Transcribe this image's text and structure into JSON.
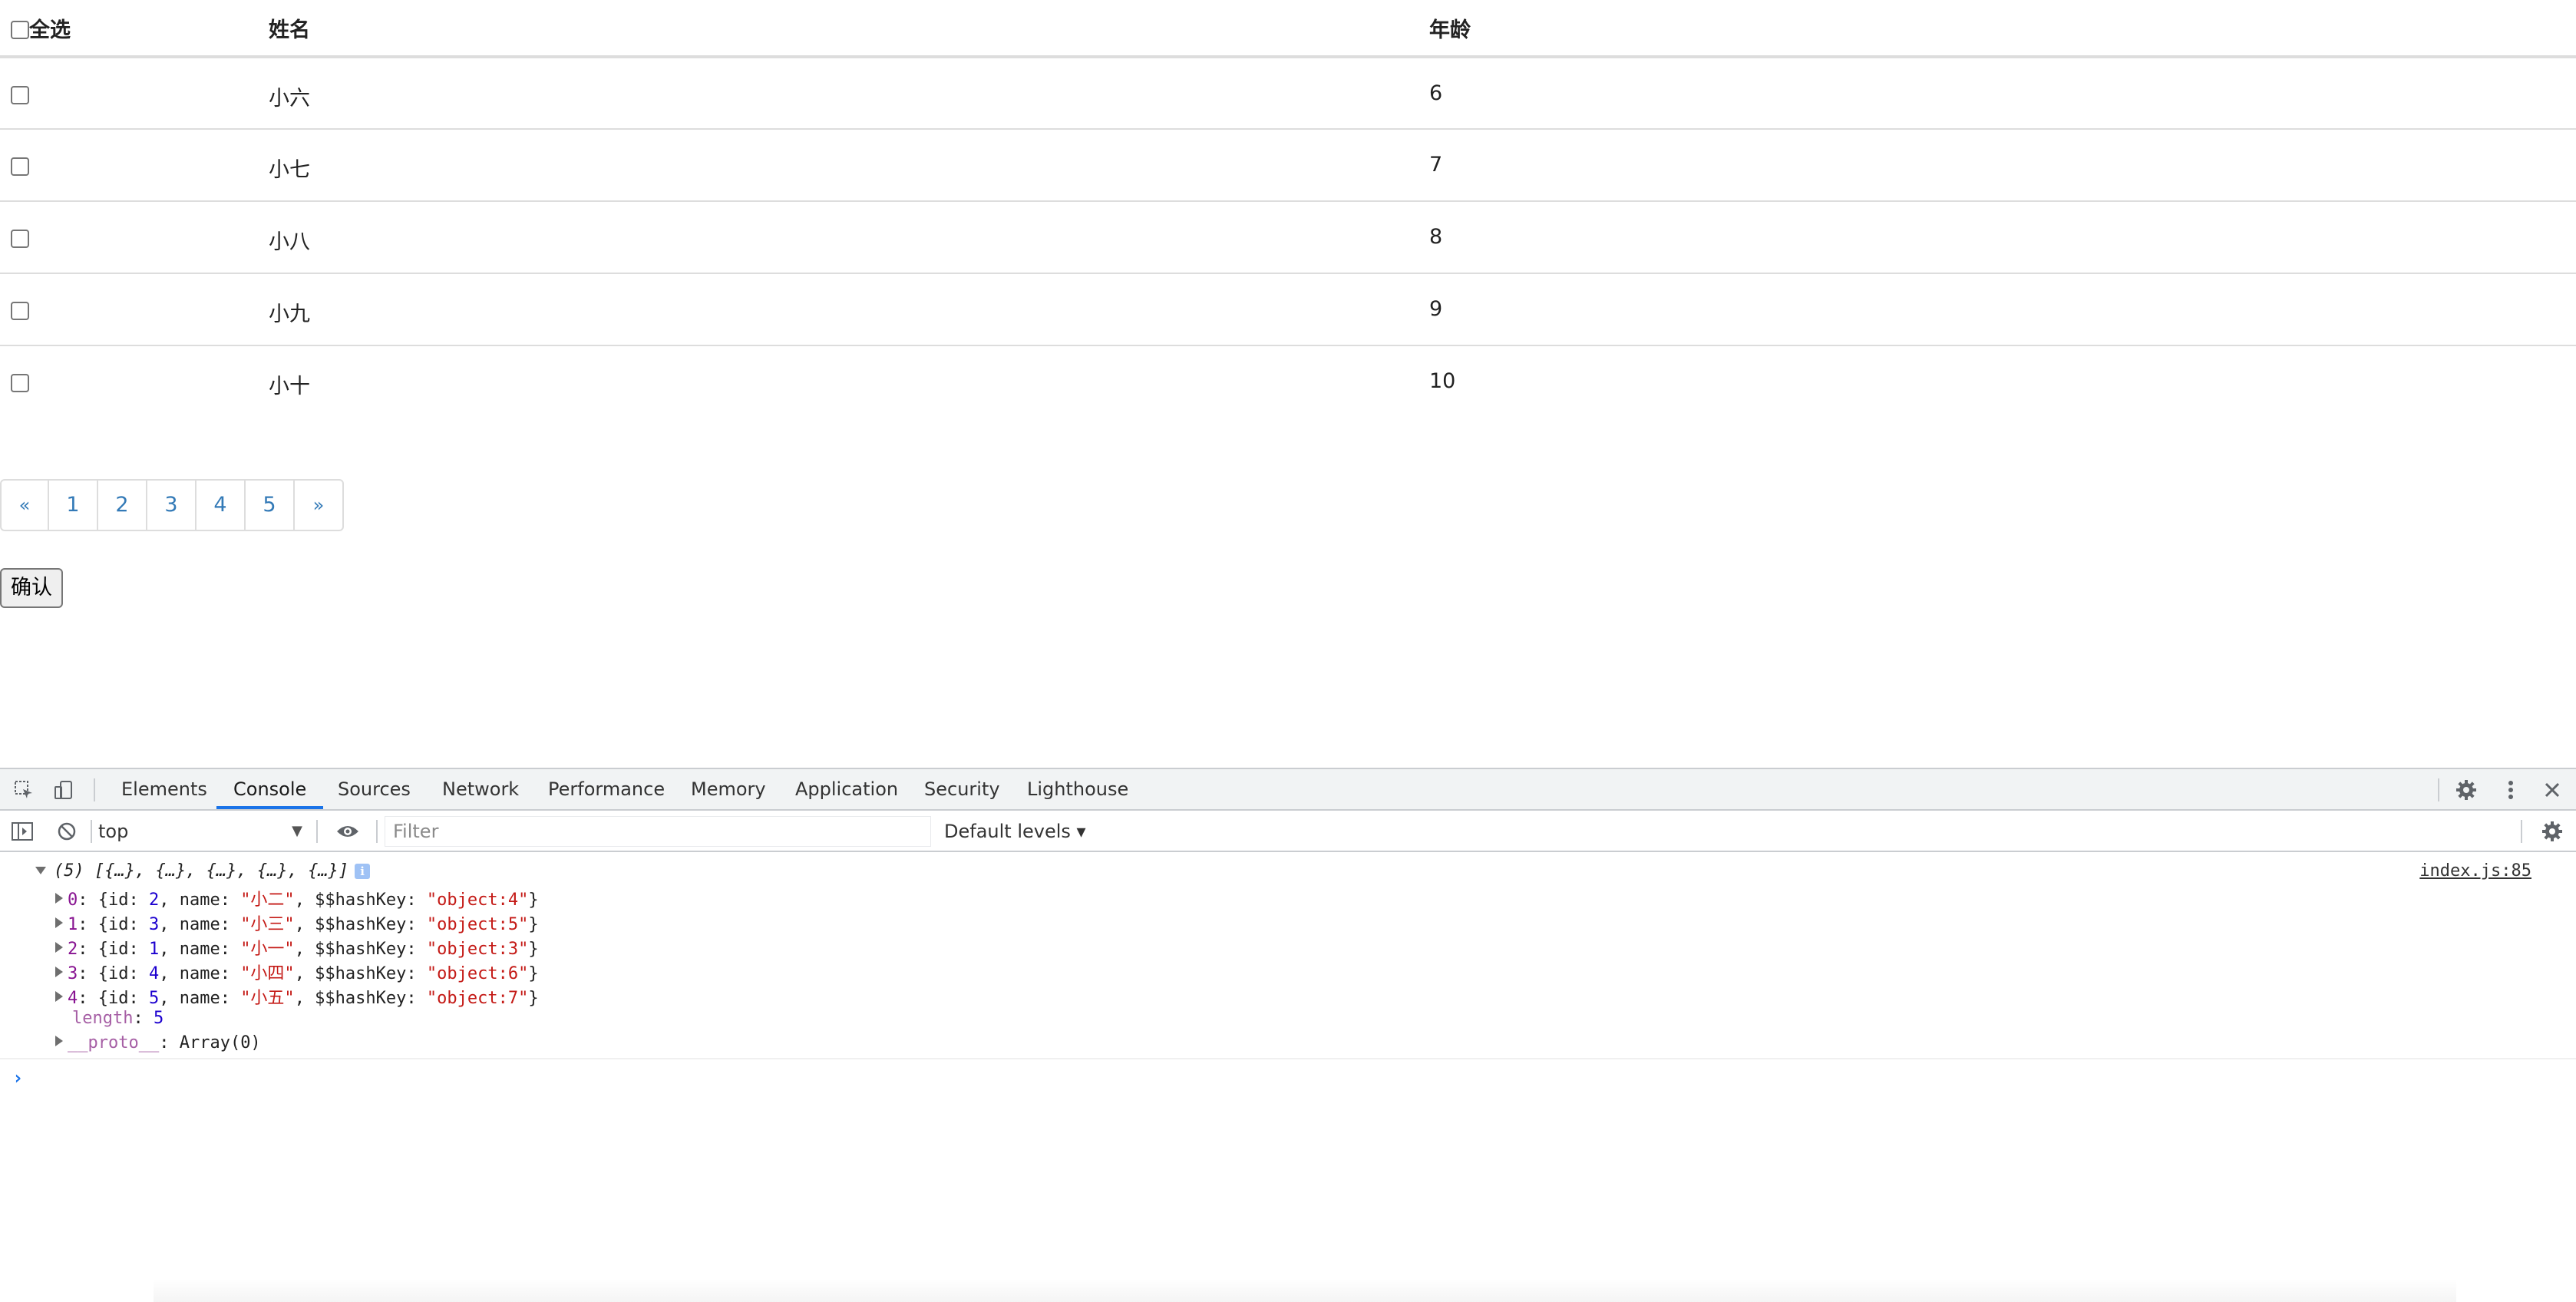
{
  "table": {
    "header": {
      "select_all": "全选",
      "name": "姓名",
      "age": "年龄"
    },
    "rows": [
      {
        "name": "小六",
        "age": "6"
      },
      {
        "name": "小七",
        "age": "7"
      },
      {
        "name": "小八",
        "age": "8"
      },
      {
        "name": "小九",
        "age": "9"
      },
      {
        "name": "小十",
        "age": "10"
      }
    ]
  },
  "pagination": {
    "prev": "«",
    "pages": [
      "1",
      "2",
      "3",
      "4",
      "5"
    ],
    "next": "»"
  },
  "confirm_label": "确认",
  "devtools": {
    "tabs": [
      "Elements",
      "Console",
      "Sources",
      "Network",
      "Performance",
      "Memory",
      "Application",
      "Security",
      "Lighthouse"
    ],
    "active_tab": "Console",
    "context": "top",
    "filter_placeholder": "Filter",
    "levels": "Default levels ▾",
    "log": {
      "summary": "(5) [{…}, {…}, {…}, {…}, {…}]",
      "source": "index.js:85",
      "items": [
        {
          "index": "0",
          "id": "2",
          "name": "\"小二\"",
          "hash": "\"object:4\""
        },
        {
          "index": "1",
          "id": "3",
          "name": "\"小三\"",
          "hash": "\"object:5\""
        },
        {
          "index": "2",
          "id": "1",
          "name": "\"小一\"",
          "hash": "\"object:3\""
        },
        {
          "index": "3",
          "id": "4",
          "name": "\"小四\"",
          "hash": "\"object:6\""
        },
        {
          "index": "4",
          "id": "5",
          "name": "\"小五\"",
          "hash": "\"object:7\""
        }
      ],
      "length_key": "length",
      "length_value": "5",
      "proto_key": "__proto__",
      "proto_value": "Array(0)"
    },
    "prompt": "›"
  },
  "icons": {
    "inspect": "inspect-icon",
    "device": "device-toggle-icon",
    "settings": "gear-icon",
    "more": "more-vertical-icon",
    "close": "close-icon",
    "sidebar": "sidebar-toggle-icon",
    "clear": "clear-console-icon",
    "eye": "eye-icon"
  },
  "colors": {
    "link": "#337ab7",
    "active_tab": "#1a73e8",
    "key": "#881391",
    "number": "#1c00cf",
    "string": "#c41a16"
  }
}
